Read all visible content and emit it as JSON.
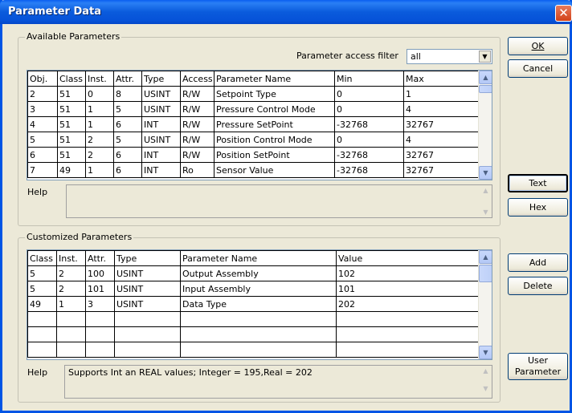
{
  "window": {
    "title": "Parameter Data",
    "close_glyph": "✕"
  },
  "available": {
    "group_label": "Available Parameters",
    "filter_label": "Parameter access filter",
    "filter_value": "all",
    "columns": [
      "Obj.",
      "Class",
      "Inst.",
      "Attr.",
      "Type",
      "Access",
      "Parameter Name",
      "Min",
      "Max"
    ],
    "rows": [
      [
        "2",
        "51",
        "0",
        "8",
        "USINT",
        "R/W",
        "Setpoint Type",
        "0",
        "1"
      ],
      [
        "3",
        "51",
        "1",
        "5",
        "USINT",
        "R/W",
        "Pressure Control Mode",
        "0",
        "4"
      ],
      [
        "4",
        "51",
        "1",
        "6",
        "INT",
        "R/W",
        "Pressure SetPoint",
        "-32768",
        "32767"
      ],
      [
        "5",
        "51",
        "2",
        "5",
        "USINT",
        "R/W",
        "Position Control Mode",
        "0",
        "4"
      ],
      [
        "6",
        "51",
        "2",
        "6",
        "INT",
        "R/W",
        "Position SetPoint",
        "-32768",
        "32767"
      ],
      [
        "7",
        "49",
        "1",
        "6",
        "INT",
        "Ro",
        "Sensor Value",
        "-32768",
        "32767"
      ]
    ],
    "help_label": "Help",
    "help_text": ""
  },
  "customized": {
    "group_label": "Customized Parameters",
    "columns": [
      "Class",
      "Inst.",
      "Attr.",
      "Type",
      "Parameter Name",
      "Value"
    ],
    "rows": [
      [
        "5",
        "2",
        "100",
        "USINT",
        "Output Assembly",
        "102"
      ],
      [
        "5",
        "2",
        "101",
        "USINT",
        "Input Assembly",
        "101"
      ],
      [
        "49",
        "1",
        "3",
        "USINT",
        "Data Type",
        "202"
      ],
      [
        "",
        "",
        "",
        "",
        "",
        ""
      ],
      [
        "",
        "",
        "",
        "",
        "",
        ""
      ],
      [
        "",
        "",
        "",
        "",
        "",
        ""
      ]
    ],
    "help_label": "Help",
    "help_text": "Supports Int an REAL values; Integer = 195,Real = 202"
  },
  "buttons": {
    "ok": "OK",
    "cancel": "Cancel",
    "text": "Text",
    "hex": "Hex",
    "add": "Add",
    "delete": "Delete",
    "user_parameter_line1": "User",
    "user_parameter_line2": "Parameter"
  }
}
